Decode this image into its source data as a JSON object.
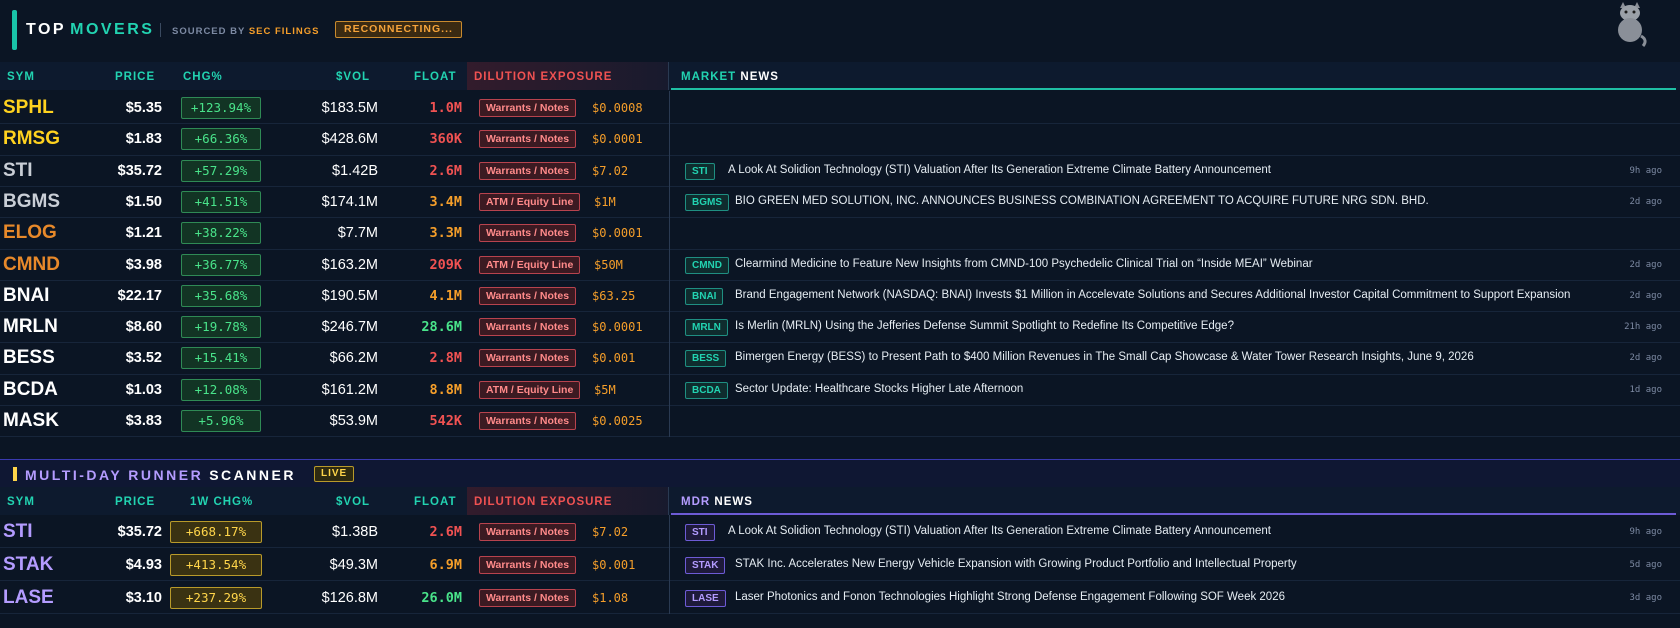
{
  "header": {
    "title_part1": "TOP",
    "title_part2": "MOVERS",
    "sourced_by": "SOURCED BY",
    "source": "SEC FILINGS",
    "status_badge": "RECONNECTING..."
  },
  "top_movers": {
    "columns": {
      "sym": "SYM",
      "price": "PRICE",
      "chg": "CHG%",
      "vol": "$VOL",
      "float": "FLOAT",
      "dilution": "DILUTION EXPOSURE",
      "news_prefix": "MARKET",
      "news_suffix": "NEWS"
    },
    "rows": [
      {
        "sym": "SPHL",
        "sym_color": "#ffd21f",
        "price": "$5.35",
        "chg": "+123.94%",
        "vol": "$183.5M",
        "float": "1.0M",
        "float_color": "#f05252",
        "dilution": "Warrants / Notes",
        "dval": "$0.0008",
        "news_tag": "",
        "news": "",
        "ago": ""
      },
      {
        "sym": "RMSG",
        "sym_color": "#ffd21f",
        "price": "$1.83",
        "chg": "+66.36%",
        "vol": "$428.6M",
        "float": "360K",
        "float_color": "#f05252",
        "dilution": "Warrants / Notes",
        "dval": "$0.0001",
        "news_tag": "",
        "news": "",
        "ago": ""
      },
      {
        "sym": "STI",
        "sym_color": "#c9ced6",
        "price": "$35.72",
        "chg": "+57.29%",
        "vol": "$1.42B",
        "float": "2.6M",
        "float_color": "#f05252",
        "dilution": "Warrants / Notes",
        "dval": "$7.02",
        "news_tag": "STI",
        "news": "A Look At Solidion Technology (STI) Valuation After Its Generation Extreme Climate Battery Announcement",
        "ago": "9h ago"
      },
      {
        "sym": "BGMS",
        "sym_color": "#c9ced6",
        "price": "$1.50",
        "chg": "+41.51%",
        "vol": "$174.1M",
        "float": "3.4M",
        "float_color": "#f59e2a",
        "dilution": "ATM / Equity Line",
        "dval": "$1M",
        "news_tag": "BGMS",
        "news": "BIO GREEN MED SOLUTION, INC. ANNOUNCES BUSINESS COMBINATION AGREEMENT TO ACQUIRE FUTURE NRG SDN. BHD.",
        "ago": "2d ago"
      },
      {
        "sym": "ELOG",
        "sym_color": "#e8892a",
        "price": "$1.21",
        "chg": "+38.22%",
        "vol": "$7.7M",
        "float": "3.3M",
        "float_color": "#f59e2a",
        "dilution": "Warrants / Notes",
        "dval": "$0.0001",
        "news_tag": "",
        "news": "",
        "ago": ""
      },
      {
        "sym": "CMND",
        "sym_color": "#e8892a",
        "price": "$3.98",
        "chg": "+36.77%",
        "vol": "$163.2M",
        "float": "209K",
        "float_color": "#f05252",
        "dilution": "ATM / Equity Line",
        "dval": "$50M",
        "news_tag": "CMND",
        "news": "Clearmind Medicine to Feature New Insights from CMND-100 Psychedelic Clinical Trial on “Inside MEAI” Webinar",
        "ago": "2d ago"
      },
      {
        "sym": "BNAI",
        "sym_color": "#ffffff",
        "price": "$22.17",
        "chg": "+35.68%",
        "vol": "$190.5M",
        "float": "4.1M",
        "float_color": "#f59e2a",
        "dilution": "Warrants / Notes",
        "dval": "$63.25",
        "news_tag": "BNAI",
        "news": "Brand Engagement Network (NASDAQ: BNAI) Invests $1 Million in Accelevate Solutions and Secures Additional Investor Capital Commitment to Support Expansion",
        "ago": "2d ago"
      },
      {
        "sym": "MRLN",
        "sym_color": "#ffffff",
        "price": "$8.60",
        "chg": "+19.78%",
        "vol": "$246.7M",
        "float": "28.6M",
        "float_color": "#49e38a",
        "dilution": "Warrants / Notes",
        "dval": "$0.0001",
        "news_tag": "MRLN",
        "news": "Is Merlin (MRLN) Using the Jefferies Defense Summit Spotlight to Redefine Its Competitive Edge?",
        "ago": "21h ago"
      },
      {
        "sym": "BESS",
        "sym_color": "#ffffff",
        "price": "$3.52",
        "chg": "+15.41%",
        "vol": "$66.2M",
        "float": "2.8M",
        "float_color": "#f05252",
        "dilution": "Warrants / Notes",
        "dval": "$0.001",
        "news_tag": "BESS",
        "news": "Bimergen Energy (BESS) to Present Path to $400 Million Revenues in The Small Cap Showcase & Water Tower Research Insights, June 9, 2026",
        "ago": "2d ago"
      },
      {
        "sym": "BCDA",
        "sym_color": "#ffffff",
        "price": "$1.03",
        "chg": "+12.08%",
        "vol": "$161.2M",
        "float": "8.8M",
        "float_color": "#f59e2a",
        "dilution": "ATM / Equity Line",
        "dval": "$5M",
        "news_tag": "BCDA",
        "news": "Sector Update: Healthcare Stocks Higher Late Afternoon",
        "ago": "1d ago"
      },
      {
        "sym": "MASK",
        "sym_color": "#ffffff",
        "price": "$3.83",
        "chg": "+5.96%",
        "vol": "$53.9M",
        "float": "542K",
        "float_color": "#f05252",
        "dilution": "Warrants / Notes",
        "dval": "$0.0025",
        "news_tag": "",
        "news": "",
        "ago": ""
      }
    ]
  },
  "mdr": {
    "title_part1": "MULTI-DAY RUNNER",
    "title_part2": "SCANNER",
    "live_badge": "LIVE",
    "columns": {
      "sym": "SYM",
      "price": "PRICE",
      "chg": "1W CHG%",
      "vol": "$VOL",
      "float": "FLOAT",
      "dilution": "DILUTION EXPOSURE",
      "news_prefix": "MDR",
      "news_suffix": "NEWS"
    },
    "rows": [
      {
        "sym": "STI",
        "sym_color": "#b49cff",
        "price": "$35.72",
        "chg": "+668.17%",
        "vol": "$1.38B",
        "float": "2.6M",
        "float_color": "#f05252",
        "dilution": "Warrants / Notes",
        "dval": "$7.02",
        "news_tag": "STI",
        "news": "A Look At Solidion Technology (STI) Valuation After Its Generation Extreme Climate Battery Announcement",
        "ago": "9h ago"
      },
      {
        "sym": "STAK",
        "sym_color": "#b49cff",
        "price": "$4.93",
        "chg": "+413.54%",
        "vol": "$49.3M",
        "float": "6.9M",
        "float_color": "#f59e2a",
        "dilution": "Warrants / Notes",
        "dval": "$0.001",
        "news_tag": "STAK",
        "news": "STAK Inc. Accelerates New Energy Vehicle Expansion with Growing Product Portfolio and Intellectual Property",
        "ago": "5d ago"
      },
      {
        "sym": "LASE",
        "sym_color": "#b49cff",
        "price": "$3.10",
        "chg": "+237.29%",
        "vol": "$126.8M",
        "float": "26.0M",
        "float_color": "#49e38a",
        "dilution": "Warrants / Notes",
        "dval": "$1.08",
        "news_tag": "LASE",
        "news": "Laser Photonics and Fonon Technologies Highlight Strong Defense Engagement Following SOF Week 2026",
        "ago": "3d ago"
      }
    ]
  }
}
